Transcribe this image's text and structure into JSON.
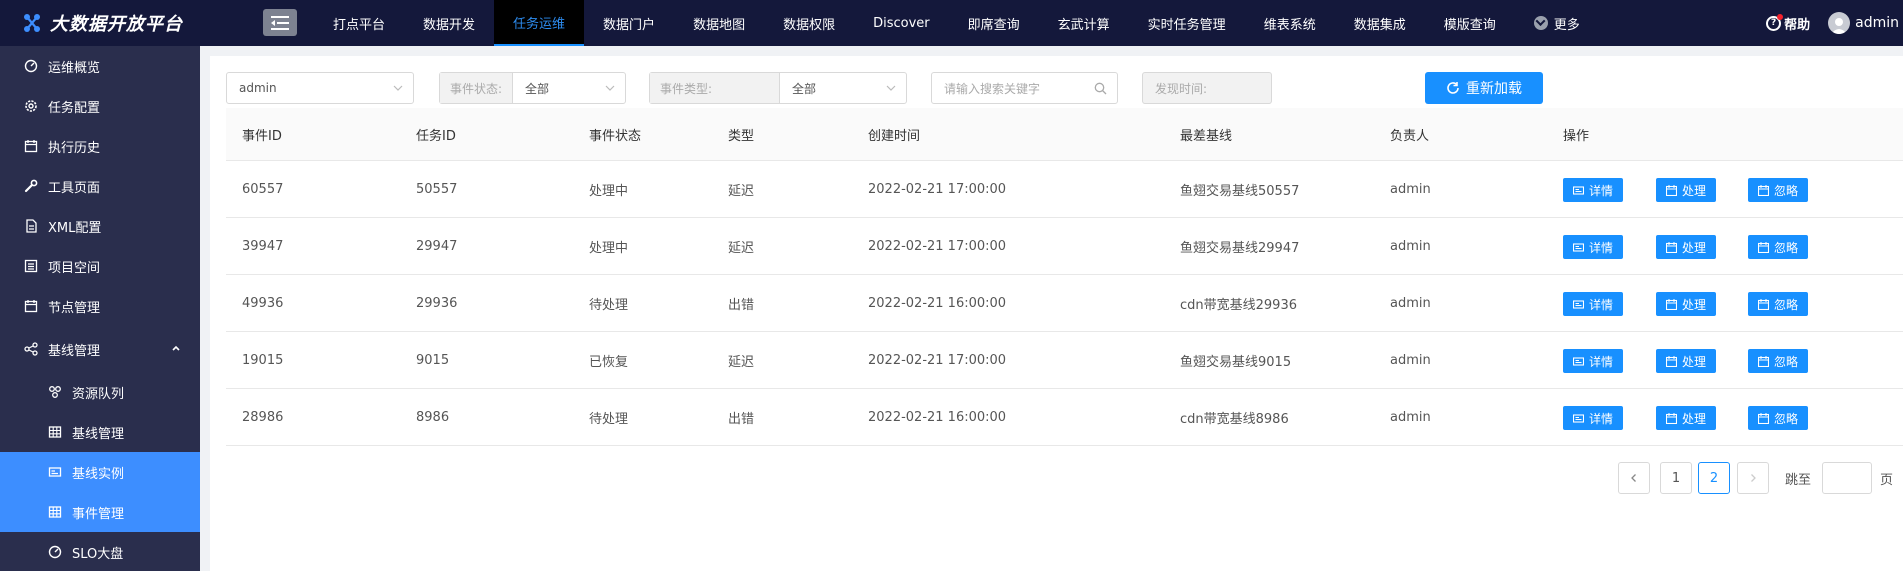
{
  "brand": {
    "title": "大数据开放平台"
  },
  "topnav": {
    "items": [
      "打点平台",
      "数据开发",
      "任务运维",
      "数据门户",
      "数据地图",
      "数据权限",
      "Discover",
      "即席查询",
      "玄武计算",
      "实时任务管理",
      "维表系统",
      "数据集成",
      "模版查询"
    ],
    "active_index": 2,
    "more_label": "更多"
  },
  "header_right": {
    "help_label": "帮助",
    "user_name": "admin"
  },
  "sidebar": {
    "items": [
      {
        "label": "运维概览",
        "icon": "dashboard-icon"
      },
      {
        "label": "任务配置",
        "icon": "gear-icon"
      },
      {
        "label": "执行历史",
        "icon": "calendar-icon"
      },
      {
        "label": "工具页面",
        "icon": "wrench-icon"
      },
      {
        "label": "XML配置",
        "icon": "file-icon"
      },
      {
        "label": "项目空间",
        "icon": "list-icon"
      },
      {
        "label": "节点管理",
        "icon": "calendar-icon"
      },
      {
        "label": "基线管理",
        "icon": "share-icon",
        "expanded": true
      },
      {
        "label": "资源队列",
        "icon": "cluster-icon",
        "sub": true
      },
      {
        "label": "基线管理",
        "icon": "table-icon",
        "sub": true
      },
      {
        "label": "基线实例",
        "icon": "card-icon",
        "sub": true,
        "active": true
      },
      {
        "label": "事件管理",
        "icon": "table-icon",
        "sub": true,
        "active": true
      },
      {
        "label": "SLO大盘",
        "icon": "dashboard-icon",
        "sub": true
      }
    ]
  },
  "filters": {
    "owner_value": "admin",
    "status_label": "事件状态:",
    "status_value": "全部",
    "type_label": "事件类型:",
    "type_value": "全部",
    "search_placeholder": "请输入搜索关键字",
    "time_placeholder": "发现时间:",
    "reload_label": "重新加载"
  },
  "table": {
    "columns": [
      "事件ID",
      "任务ID",
      "事件状态",
      "类型",
      "创建时间",
      "最差基线",
      "负责人",
      "操作"
    ],
    "rows": [
      {
        "event_id": "60557",
        "task_id": "50557",
        "status": "处理中",
        "type": "延迟",
        "created": "2022-02-21 17:00:00",
        "baseline": "鱼翅交易基线50557",
        "owner": "admin"
      },
      {
        "event_id": "39947",
        "task_id": "29947",
        "status": "处理中",
        "type": "延迟",
        "created": "2022-02-21 17:00:00",
        "baseline": "鱼翅交易基线29947",
        "owner": "admin"
      },
      {
        "event_id": "49936",
        "task_id": "29936",
        "status": "待处理",
        "type": "出错",
        "created": "2022-02-21 16:00:00",
        "baseline": "cdn带宽基线29936",
        "owner": "admin"
      },
      {
        "event_id": "19015",
        "task_id": "9015",
        "status": "已恢复",
        "type": "延迟",
        "created": "2022-02-21 17:00:00",
        "baseline": "鱼翅交易基线9015",
        "owner": "admin"
      },
      {
        "event_id": "28986",
        "task_id": "8986",
        "status": "待处理",
        "type": "出错",
        "created": "2022-02-21 16:00:00",
        "baseline": "cdn带宽基线8986",
        "owner": "admin"
      }
    ],
    "actions": {
      "detail": "详情",
      "handle": "处理",
      "ignore": "忽略"
    }
  },
  "pagination": {
    "pages": [
      "1",
      "2"
    ],
    "current_page": "2",
    "jump_label": "跳至",
    "page_suffix": "页"
  },
  "colors": {
    "topbar": "#14183b",
    "sidebar": "#2a2e4d",
    "accent": "#1890ff"
  }
}
